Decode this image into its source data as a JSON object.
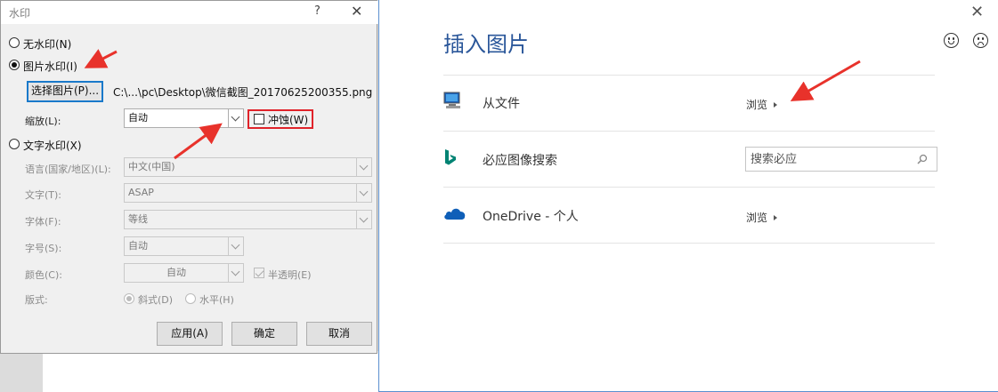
{
  "dialog": {
    "title": "水印",
    "help": "?",
    "close": "✕",
    "radio_none": "无水印(N)",
    "radio_picture": "图片水印(I)",
    "select_picture_button": "选择图片(P)...",
    "picture_path": "C:\\...\\pc\\Desktop\\微信截图_20170625200355.png",
    "scale_label": "缩放(L):",
    "scale_value": "自动",
    "washout_label": "冲蚀(W)",
    "radio_text": "文字水印(X)",
    "language_label": "语言(国家/地区)(L):",
    "language_value": "中文(中国)",
    "text_label": "文字(T):",
    "text_value": "ASAP",
    "font_label": "字体(F):",
    "font_value": "等线",
    "size_label": "字号(S):",
    "size_value": "自动",
    "color_label": "颜色(C):",
    "color_value": "自动",
    "semitransparent_label": "半透明(E)",
    "layout_label": "版式:",
    "diagonal_label": "斜式(D)",
    "horizontal_label": "水平(H)",
    "apply_button": "应用(A)",
    "ok_button": "确定",
    "cancel_button": "取消"
  },
  "insert_pictures": {
    "title": "插入图片",
    "close": "✕",
    "sources": [
      {
        "label": "从文件",
        "action": "浏览",
        "icon": "computer-icon"
      },
      {
        "label": "必应图像搜索",
        "search_placeholder": "搜索必应",
        "icon": "bing-icon"
      },
      {
        "label": "OneDrive - 个人",
        "action": "浏览",
        "icon": "onedrive-cloud-icon"
      }
    ]
  },
  "colors": {
    "accent_blue": "#2b579a",
    "highlight_red": "#e0232a",
    "focus_blue": "#1979ca"
  }
}
